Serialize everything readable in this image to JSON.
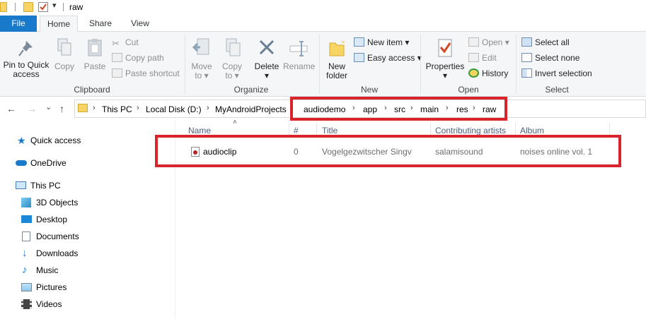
{
  "window": {
    "title": "raw"
  },
  "tabs": [
    {
      "label": "File"
    },
    {
      "label": "Home"
    },
    {
      "label": "Share"
    },
    {
      "label": "View"
    }
  ],
  "ribbon": {
    "clipboard": {
      "label": "Clipboard",
      "pin": "Pin to Quick access",
      "pin_line1": "Pin to Quick",
      "pin_line2": "access",
      "copy": "Copy",
      "paste": "Paste",
      "cut": "Cut",
      "copy_path": "Copy path",
      "paste_shortcut": "Paste shortcut"
    },
    "organize": {
      "label": "Organize",
      "move_to_1": "Move",
      "move_to_2": "to",
      "copy_to_1": "Copy",
      "copy_to_2": "to",
      "delete": "Delete",
      "rename": "Rename"
    },
    "new": {
      "label": "New",
      "new_folder_1": "New",
      "new_folder_2": "folder",
      "new_item": "New item",
      "easy_access": "Easy access"
    },
    "open": {
      "label": "Open",
      "properties": "Properties",
      "open": "Open",
      "edit": "Edit",
      "history": "History"
    },
    "select": {
      "label": "Select",
      "select_all": "Select all",
      "select_none": "Select none",
      "invert": "Invert selection"
    }
  },
  "address": {
    "crumbs": [
      "This PC",
      "Local Disk (D:)",
      "MyAndroidProjects",
      "audiodemo",
      "app",
      "src",
      "main",
      "res",
      "raw"
    ]
  },
  "navpane": {
    "quick_access": "Quick access",
    "onedrive": "OneDrive",
    "this_pc": "This PC",
    "objects3d": "3D Objects",
    "desktop": "Desktop",
    "documents": "Documents",
    "downloads": "Downloads",
    "music": "Music",
    "pictures": "Pictures",
    "videos": "Videos"
  },
  "columns": {
    "name": "Name",
    "number": "#",
    "title": "Title",
    "artists": "Contributing artists",
    "album": "Album"
  },
  "files": [
    {
      "name": "audioclip",
      "number": "0",
      "title": "Vogelgezwitscher Singv",
      "artists": "salamisound",
      "album": "noises online vol. 1"
    }
  ],
  "colors": {
    "file_tab": "#1979ca",
    "highlight": "#d9242b",
    "folder": "#f7d463"
  }
}
